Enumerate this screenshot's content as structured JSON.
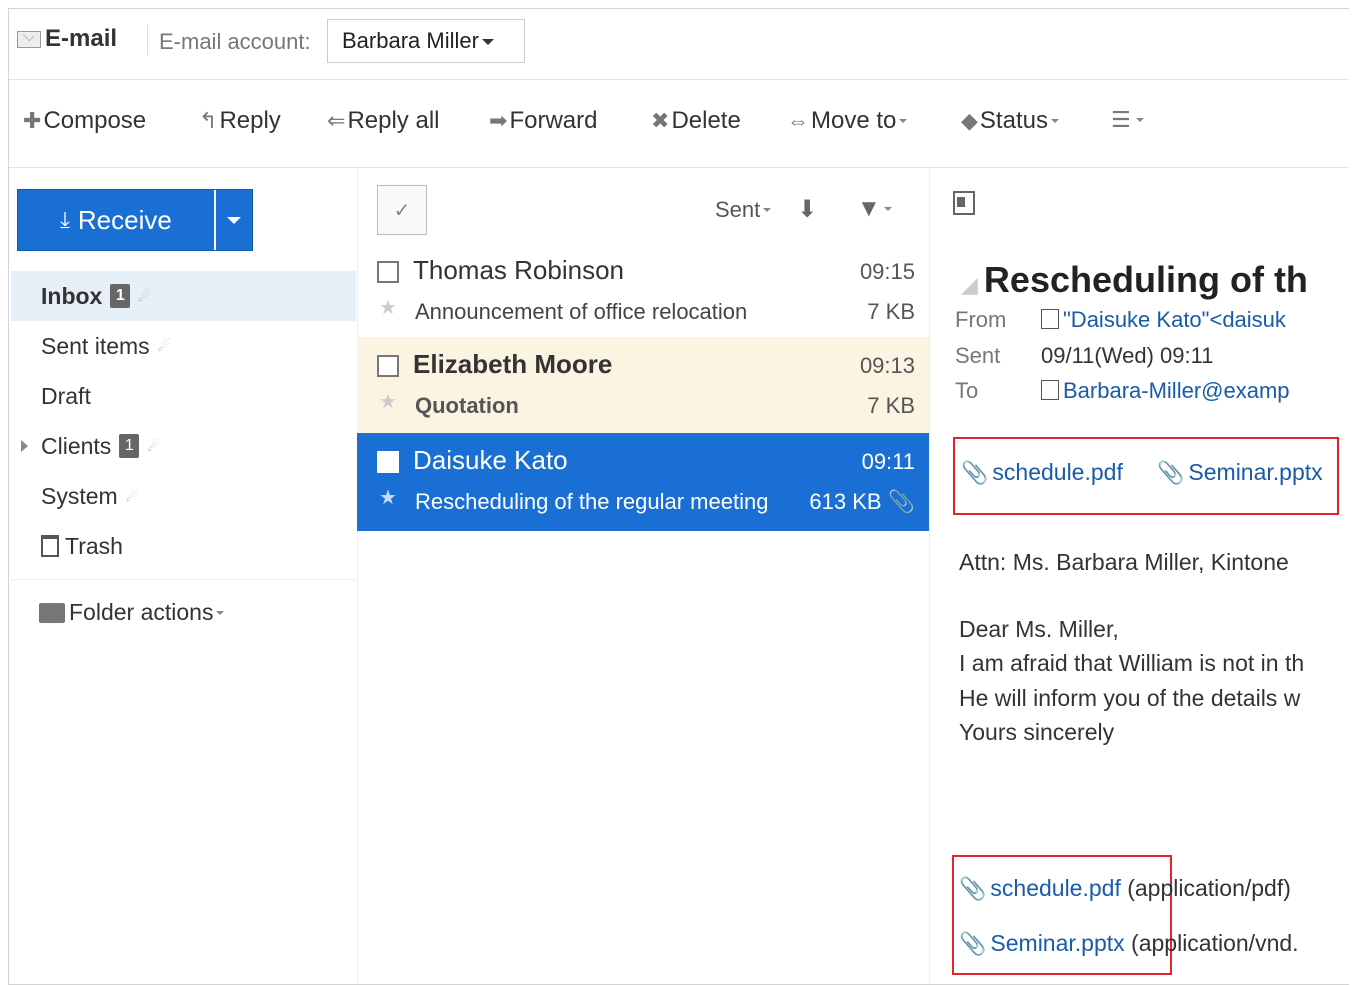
{
  "header": {
    "app_title": "E-mail",
    "account_label": "E-mail account:",
    "account_value": "Barbara Miller"
  },
  "toolbar": {
    "compose": "Compose",
    "reply": "Reply",
    "reply_all": "Reply all",
    "forward": "Forward",
    "delete": "Delete",
    "move_to": "Move to",
    "status": "Status"
  },
  "sidebar": {
    "receive_label": "Receive",
    "folders": [
      {
        "label": "Inbox",
        "badge": "1"
      },
      {
        "label": "Sent items"
      },
      {
        "label": "Draft"
      },
      {
        "label": "Clients",
        "badge": "1"
      },
      {
        "label": "System"
      },
      {
        "label": "Trash"
      }
    ],
    "folder_actions": "Folder actions"
  },
  "list": {
    "sort_label": "Sent",
    "messages": [
      {
        "sender": "Thomas Robinson",
        "time": "09:15",
        "subject": "Announcement of office relocation",
        "size": "7 KB",
        "state": "read"
      },
      {
        "sender": "Elizabeth Moore",
        "time": "09:13",
        "subject": "Quotation",
        "size": "7 KB",
        "state": "unread"
      },
      {
        "sender": "Daisuke Kato",
        "time": "09:11",
        "subject": "Rescheduling of the regular meeting",
        "size": "613 KB",
        "state": "selected",
        "has_attachment": true
      }
    ]
  },
  "preview": {
    "title": "Rescheduling of th",
    "from_label": "From",
    "from_value": "\"Daisuke Kato\"<daisuk",
    "sent_label": "Sent",
    "sent_value": "09/11(Wed) 09:11",
    "to_label": "To",
    "to_value": "Barbara-Miller@examp",
    "attachments_top": [
      "schedule.pdf",
      "Seminar.pptx"
    ],
    "body": [
      "Attn: Ms. Barbara Miller, Kintone",
      "Dear Ms. Miller,",
      "I am afraid that William is not in th",
      "He will inform you of the details w",
      "Yours sincerely"
    ],
    "attachments_bottom": [
      {
        "name": "schedule.pdf",
        "type": " (application/pdf)"
      },
      {
        "name": "Seminar.pptx",
        "type": " (application/vnd."
      }
    ]
  },
  "colors": {
    "accent": "#1a6fd4",
    "unread_bg": "#fbf4e3",
    "highlight_box": "#e4232b",
    "link": "#1a5ba8"
  }
}
